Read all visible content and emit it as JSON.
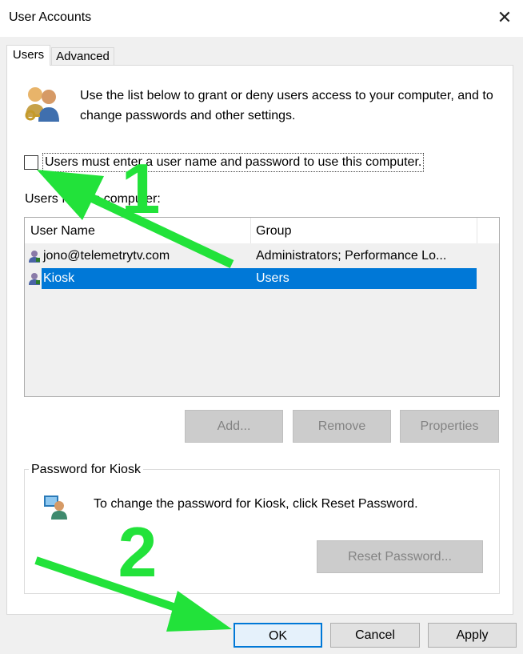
{
  "window": {
    "title": "User Accounts",
    "close_glyph": "✕"
  },
  "tabs": [
    {
      "label": "Users",
      "selected": true
    },
    {
      "label": "Advanced",
      "selected": false
    }
  ],
  "intro_text": "Use the list below to grant or deny users access to your computer, and to change passwords and other settings.",
  "require_login": {
    "label": "Users must enter a user name and password to use this computer.",
    "checked": false
  },
  "users_list": {
    "label": "Users for this computer:",
    "columns": [
      "User Name",
      "Group"
    ],
    "rows": [
      {
        "name": "jono@telemetrytv.com",
        "group": "Administrators; Performance Lo...",
        "selected": false
      },
      {
        "name": "Kiosk",
        "group": "Users",
        "selected": true
      }
    ]
  },
  "list_buttons": {
    "add": "Add...",
    "remove": "Remove",
    "properties": "Properties"
  },
  "password_group": {
    "title": "Password for Kiosk",
    "text": "To change the password for Kiosk, click Reset Password.",
    "reset_button": "Reset Password..."
  },
  "dialog_buttons": {
    "ok": "OK",
    "cancel": "Cancel",
    "apply": "Apply"
  },
  "annotations": {
    "step1": "1",
    "step2": "2",
    "color": "#22e23a"
  },
  "colors": {
    "selection": "#0078d7",
    "background": "#f0f0f0"
  }
}
